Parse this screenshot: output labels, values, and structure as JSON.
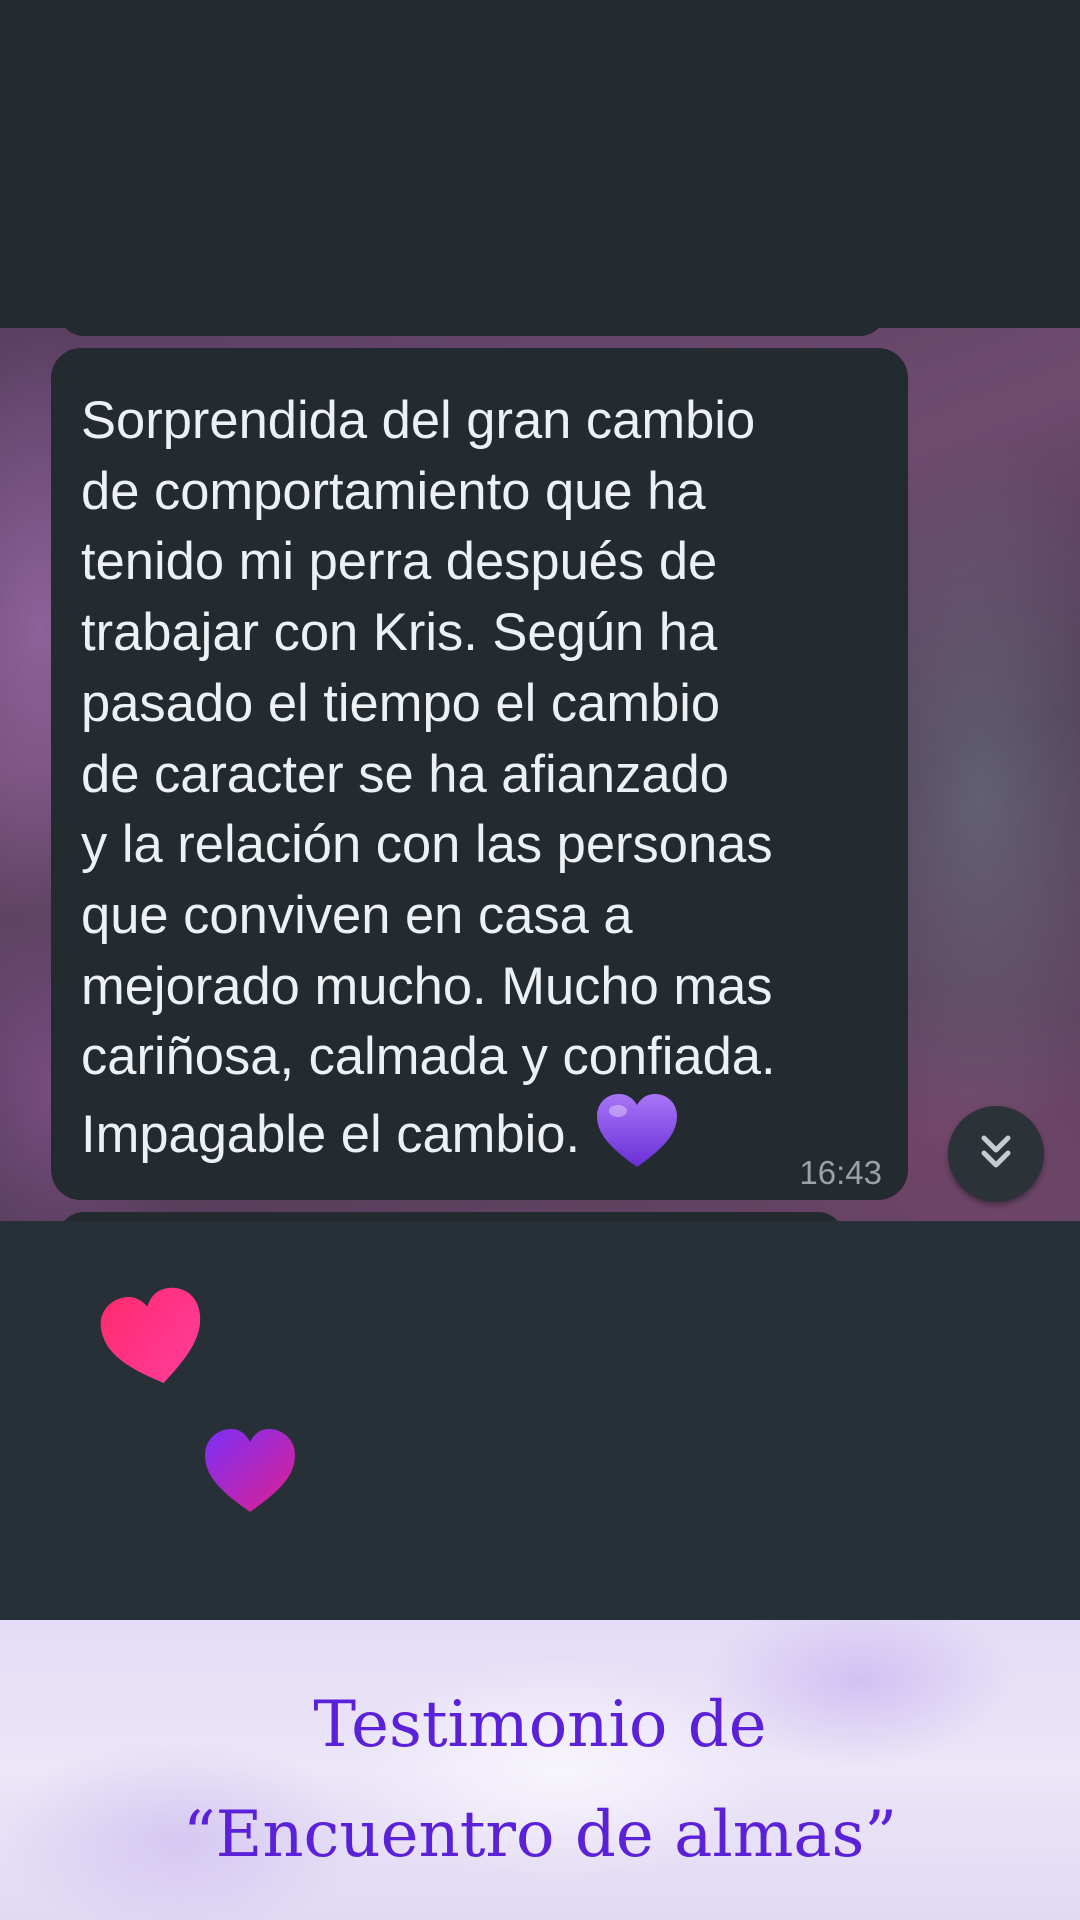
{
  "message": {
    "lines": [
      "Sorprendida del gran cambio",
      "de comportamiento que ha",
      "tenido mi perra después de",
      "trabajar con Kris. Según ha",
      "pasado el tiempo el cambio",
      "de caracter se ha afianzado",
      "y la relación con las personas",
      "que conviven en casa a",
      "mejorado mucho. Mucho mas",
      "cariñosa, calmada y confiada."
    ],
    "last_line": "Impagable el cambio.",
    "emoji": "purple-heart",
    "time": "16:43"
  },
  "scroll_button": {
    "icon": "double-chevron-down-icon"
  },
  "stickers": [
    {
      "icon": "pink-heart-icon",
      "colors": [
        "#ff2a6d",
        "#ff3fa0"
      ]
    },
    {
      "icon": "purple-heart-icon",
      "colors": [
        "#7b2ff7",
        "#e0208f"
      ]
    }
  ],
  "footer": {
    "line1": "Testimonio de",
    "line2": "“Encuentro de almas”",
    "color": "#5b21d8"
  },
  "colors": {
    "bubble": "#232a30",
    "text": "#eef1f3",
    "timestamp": "#9aa2a8"
  }
}
